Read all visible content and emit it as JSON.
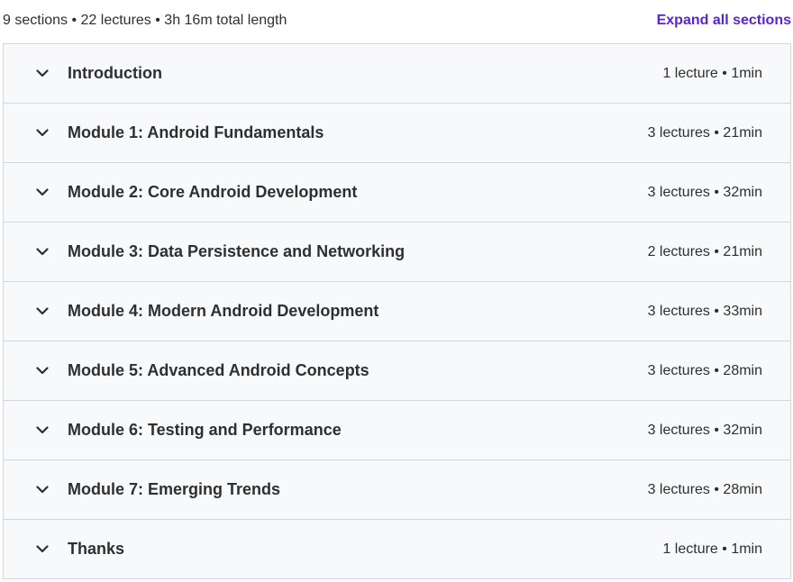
{
  "summary": {
    "text": "9 sections • 22 lectures • 3h 16m total length",
    "expand_label": "Expand all sections"
  },
  "sections": [
    {
      "title": "Introduction",
      "meta": "1 lecture • 1min"
    },
    {
      "title": "Module 1: Android Fundamentals",
      "meta": "3 lectures • 21min"
    },
    {
      "title": "Module 2: Core Android Development",
      "meta": "3 lectures • 32min"
    },
    {
      "title": "Module 3: Data Persistence and Networking",
      "meta": "2 lectures • 21min"
    },
    {
      "title": "Module 4: Modern Android Development",
      "meta": "3 lectures • 33min"
    },
    {
      "title": "Module 5: Advanced Android Concepts",
      "meta": "3 lectures • 28min"
    },
    {
      "title": "Module 6: Testing and Performance",
      "meta": "3 lectures • 32min"
    },
    {
      "title": "Module 7: Emerging Trends",
      "meta": "3 lectures • 28min"
    },
    {
      "title": "Thanks",
      "meta": "1 lecture • 1min"
    }
  ],
  "icons": {
    "section_toggle": "chevron-down-icon"
  },
  "colors": {
    "accent": "#5624d0",
    "row_background": "#f7f9fa",
    "border": "#d1d7dc",
    "text": "#2d2f31"
  }
}
